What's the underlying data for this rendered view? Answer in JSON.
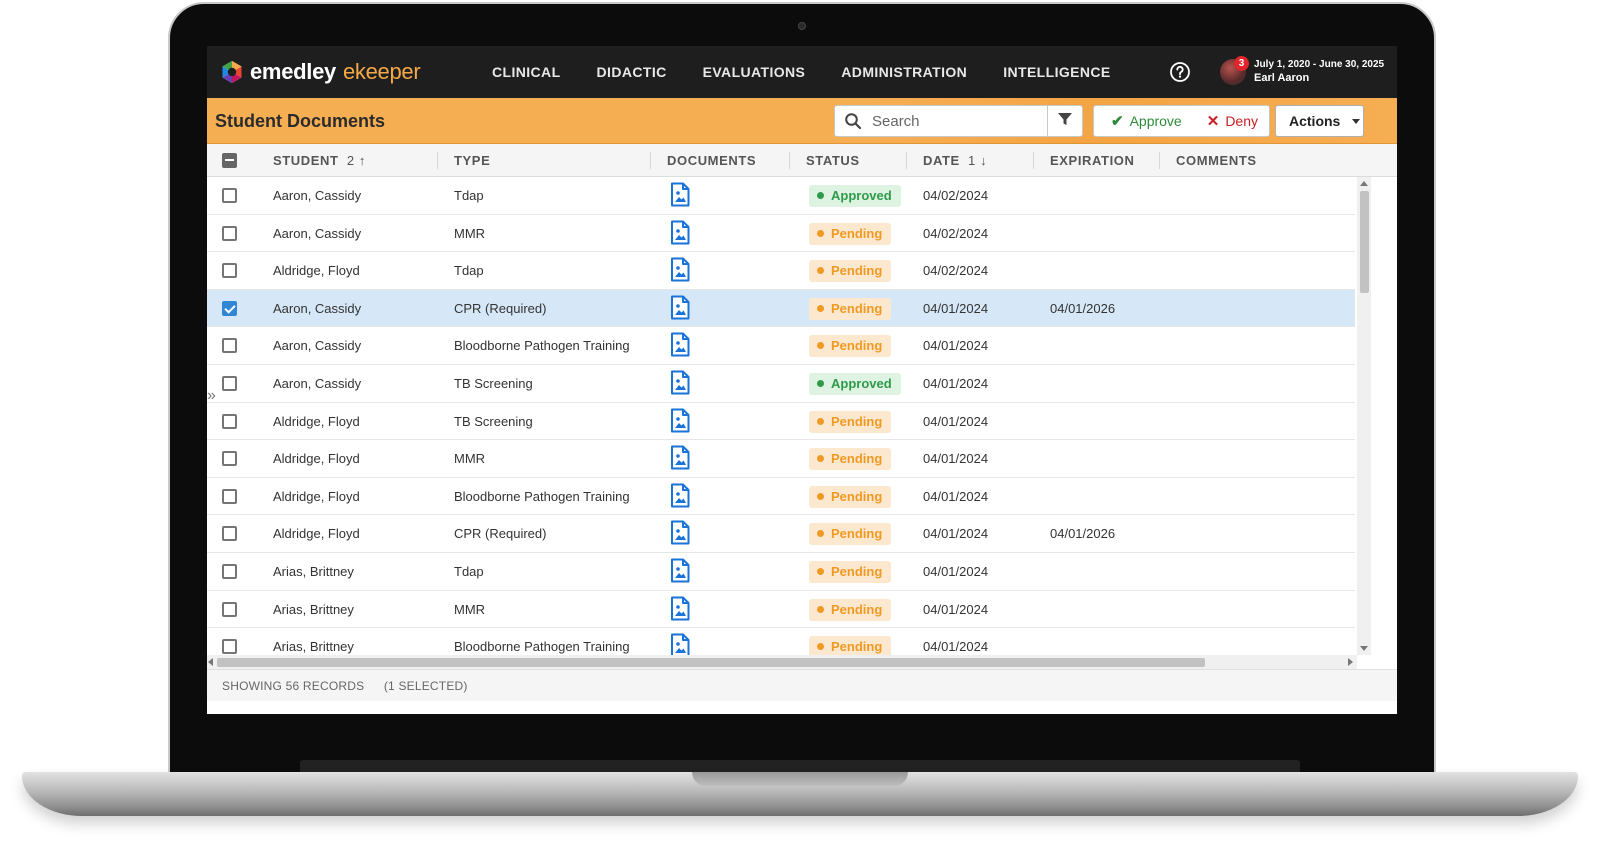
{
  "app": {
    "brand_primary": "emedley",
    "brand_secondary": "ekeeper",
    "accent_color": "#f6ae53"
  },
  "nav": {
    "items": [
      {
        "label": "CLINICAL"
      },
      {
        "label": "DIDACTIC"
      },
      {
        "label": "EVALUATIONS"
      },
      {
        "label": "ADMINISTRATION"
      },
      {
        "label": "INTELLIGENCE"
      }
    ],
    "help_icon": "help-circle-icon"
  },
  "user": {
    "notification_count": "3",
    "date_range": "July 1, 2020 - June 30, 2025",
    "name": "Earl Aaron"
  },
  "toolbar": {
    "title": "Student Documents",
    "search_placeholder": "Search",
    "approve_label": "Approve",
    "deny_label": "Deny",
    "actions_label": "Actions"
  },
  "table": {
    "columns": [
      {
        "label": "STUDENT",
        "sort": "2 ↑"
      },
      {
        "label": "TYPE"
      },
      {
        "label": "DOCUMENTS"
      },
      {
        "label": "STATUS"
      },
      {
        "label": "DATE",
        "sort": "1 ↓"
      },
      {
        "label": "EXPIRATION"
      },
      {
        "label": "COMMENTS"
      }
    ],
    "rows": [
      {
        "student": "Aaron, Cassidy",
        "type": "Tdap",
        "status": "Approved",
        "date": "04/02/2024",
        "expiration": "",
        "comments": "",
        "selected": false
      },
      {
        "student": "Aaron, Cassidy",
        "type": "MMR",
        "status": "Pending",
        "date": "04/02/2024",
        "expiration": "",
        "comments": "",
        "selected": false
      },
      {
        "student": "Aldridge, Floyd",
        "type": "Tdap",
        "status": "Pending",
        "date": "04/02/2024",
        "expiration": "",
        "comments": "",
        "selected": false
      },
      {
        "student": "Aaron, Cassidy",
        "type": "CPR (Required)",
        "status": "Pending",
        "date": "04/01/2024",
        "expiration": "04/01/2026",
        "comments": "",
        "selected": true
      },
      {
        "student": "Aaron, Cassidy",
        "type": "Bloodborne Pathogen Training",
        "status": "Pending",
        "date": "04/01/2024",
        "expiration": "",
        "comments": "",
        "selected": false
      },
      {
        "student": "Aaron, Cassidy",
        "type": "TB Screening",
        "status": "Approved",
        "date": "04/01/2024",
        "expiration": "",
        "comments": "",
        "selected": false
      },
      {
        "student": "Aldridge, Floyd",
        "type": "TB Screening",
        "status": "Pending",
        "date": "04/01/2024",
        "expiration": "",
        "comments": "",
        "selected": false
      },
      {
        "student": "Aldridge, Floyd",
        "type": "MMR",
        "status": "Pending",
        "date": "04/01/2024",
        "expiration": "",
        "comments": "",
        "selected": false
      },
      {
        "student": "Aldridge, Floyd",
        "type": "Bloodborne Pathogen Training",
        "status": "Pending",
        "date": "04/01/2024",
        "expiration": "",
        "comments": "",
        "selected": false
      },
      {
        "student": "Aldridge, Floyd",
        "type": "CPR (Required)",
        "status": "Pending",
        "date": "04/01/2024",
        "expiration": "04/01/2026",
        "comments": "",
        "selected": false
      },
      {
        "student": "Arias, Brittney",
        "type": "Tdap",
        "status": "Pending",
        "date": "04/01/2024",
        "expiration": "",
        "comments": "",
        "selected": false
      },
      {
        "student": "Arias, Brittney",
        "type": "MMR",
        "status": "Pending",
        "date": "04/01/2024",
        "expiration": "",
        "comments": "",
        "selected": false
      },
      {
        "student": "Arias, Brittney",
        "type": "Bloodborne Pathogen Training",
        "status": "Pending",
        "date": "04/01/2024",
        "expiration": "",
        "comments": "",
        "selected": false
      }
    ]
  },
  "footer": {
    "records": "SHOWING 56 RECORDS",
    "selected": "(1 SELECTED)"
  },
  "colors": {
    "approved": "#2e9a4a",
    "pending": "#f09a24",
    "selected_row": "#d6e8f7"
  }
}
